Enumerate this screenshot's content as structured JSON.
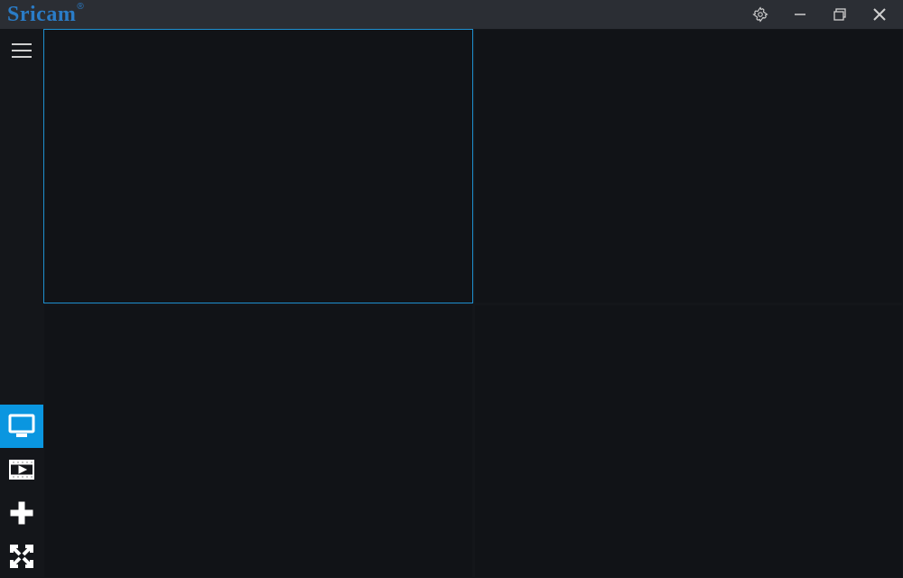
{
  "app": {
    "brand": "Sricam",
    "registered_mark": "®"
  },
  "titlebar": {
    "icons": [
      "settings",
      "minimize",
      "restore",
      "close"
    ]
  },
  "sidebar": {
    "top_icon": "menu",
    "tools": [
      {
        "name": "live-view",
        "active": true
      },
      {
        "name": "playback",
        "active": false
      },
      {
        "name": "add-device",
        "active": false
      },
      {
        "name": "fullscreen",
        "active": false
      }
    ]
  },
  "grid": {
    "rows": 2,
    "cols": 2,
    "selected_index": 0,
    "cells": [
      {
        "index": 0,
        "content": ""
      },
      {
        "index": 1,
        "content": ""
      },
      {
        "index": 2,
        "content": ""
      },
      {
        "index": 3,
        "content": ""
      }
    ]
  }
}
